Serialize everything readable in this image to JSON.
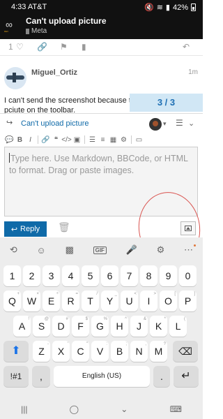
{
  "status_bar": {
    "time": "4:33",
    "carrier": "AT&T",
    "battery": "42%"
  },
  "topic": {
    "title": "Can't upload picture",
    "category": "Meta"
  },
  "post_actions": {
    "like_count": "1"
  },
  "post": {
    "username": "Miguel_Ortiz",
    "time": "1m",
    "text_line1": "I can't send the screenshot because th",
    "text_line2": "pciute on the toolbar."
  },
  "progress": {
    "label": "3 / 3"
  },
  "composer": {
    "reply_title": "Can't upload picture",
    "placeholder": "Type here. Use Markdown, BBCode, or HTML to format. Drag or paste images.",
    "reply_label": "Reply"
  },
  "keyboard": {
    "numbers": [
      "1",
      "2",
      "3",
      "4",
      "5",
      "6",
      "7",
      "8",
      "9",
      "0"
    ],
    "row1": [
      {
        "k": "Q",
        "s": "+"
      },
      {
        "k": "W",
        "s": "×"
      },
      {
        "k": "E",
        "s": "÷"
      },
      {
        "k": "R",
        "s": "="
      },
      {
        "k": "T",
        "s": "/"
      },
      {
        "k": "Y",
        "s": "_"
      },
      {
        "k": "U",
        "s": "<"
      },
      {
        "k": "I",
        "s": ">"
      },
      {
        "k": "O",
        "s": "["
      },
      {
        "k": "P",
        "s": "]"
      }
    ],
    "row2": [
      {
        "k": "A",
        "s": "!"
      },
      {
        "k": "S",
        "s": "@"
      },
      {
        "k": "D",
        "s": "#"
      },
      {
        "k": "F",
        "s": "$"
      },
      {
        "k": "G",
        "s": "%"
      },
      {
        "k": "H",
        "s": "^"
      },
      {
        "k": "J",
        "s": "&"
      },
      {
        "k": "K",
        "s": "*"
      },
      {
        "k": "L",
        "s": "("
      }
    ],
    "row3": [
      {
        "k": "Z",
        "s": "-"
      },
      {
        "k": "X",
        "s": "'"
      },
      {
        "k": "C",
        "s": "\""
      },
      {
        "k": "V",
        "s": ":"
      },
      {
        "k": "B",
        "s": ";"
      },
      {
        "k": "N",
        "s": ","
      },
      {
        "k": "M",
        "s": "?"
      }
    ],
    "symbols_label": "!#1",
    "comma": ",",
    "space_label": "English (US)",
    "period": "."
  }
}
